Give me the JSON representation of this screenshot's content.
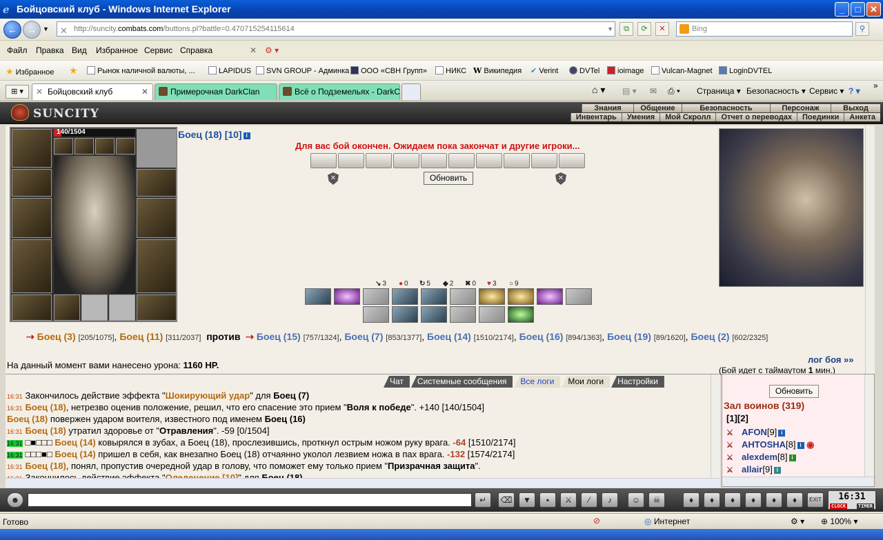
{
  "window": {
    "title": "Бойцовский клуб - Windows Internet Explorer",
    "minimize": "_",
    "maximize": "□",
    "close": "✕"
  },
  "address": {
    "url_prefix": "http://suncity.",
    "url_domain": "combats.com",
    "url_suffix": "/buttons.pl?battle=0.470715254115614",
    "search_placeholder": "Bing"
  },
  "menu": [
    "Файл",
    "Правка",
    "Вид",
    "Избранное",
    "Сервис",
    "Справка"
  ],
  "favorites": {
    "label": "Избранное",
    "items": [
      "Рынок наличной валюты, ...",
      "LAPIDUS",
      "SVN GROUP - Админка",
      "ООО «СВН Групп»",
      "НИКС",
      "Википедия",
      "Verint",
      "DVTel",
      "ioimage",
      "Vulcan-Magnet",
      "LoginDVTEL"
    ]
  },
  "tabs": [
    "Бойцовский клуб",
    "Примерочная DarkClan",
    "Всё о Подземельях - DarkCl..."
  ],
  "commandbar": [
    "Страница",
    "Безопасность",
    "Сервис"
  ],
  "game": {
    "logo": "SUNCITY",
    "nav_top": [
      "Знания",
      "Общение",
      "Безопасность",
      "Персонаж",
      "Выход"
    ],
    "nav_bottom": [
      "Инвентарь",
      "Умения",
      "Мой Скролл",
      "Отчет о переводах",
      "Поединки",
      "Анкета"
    ],
    "hp_text": "140/1504",
    "hp_fraction": 0.093,
    "fighter_name": "Боец (18)",
    "fighter_extra": "[10]",
    "battle_message": "Для вас бой окончен. Ожидаем пока закончат и другие игроки...",
    "refresh_label": "Обновить",
    "stats": [
      {
        "glyph": "↘",
        "value": "3"
      },
      {
        "glyph": "●",
        "value": "0"
      },
      {
        "glyph": "↻",
        "value": "5"
      },
      {
        "glyph": "◆",
        "value": "2"
      },
      {
        "glyph": "✖",
        "value": "0"
      },
      {
        "glyph": "♥",
        "value": "3"
      },
      {
        "glyph": "○",
        "value": "9"
      }
    ],
    "team1": [
      {
        "name": "Боец (3)",
        "hp": "[205/1075]"
      },
      {
        "name": "Боец (11)",
        "hp": "[311/2037]"
      }
    ],
    "versus": "против",
    "team2": [
      {
        "name": "Боец (15)",
        "hp": "[757/1324]"
      },
      {
        "name": "Боец (7)",
        "hp": "[853/1377]"
      },
      {
        "name": "Боец (14)",
        "hp": "[1510/2174]"
      },
      {
        "name": "Боец (16)",
        "hp": "[894/1363]"
      },
      {
        "name": "Боец (19)",
        "hp": "[89/1620]"
      },
      {
        "name": "Боец (2)",
        "hp": "[602/2325]"
      }
    ],
    "damage_prefix": "На данный момент вами нанесено урона:",
    "damage_value": "1160 HP.",
    "log_link": "лог боя »»",
    "timeout_text": "(Бой идет с таймаутом",
    "timeout_value": "1",
    "timeout_unit": "мин.)"
  },
  "log": {
    "tabs": [
      "Чат",
      "Системные сообщения",
      "Все логи",
      "Мои логи",
      "Настройки"
    ],
    "lines": [
      {
        "time": "16:31",
        "green": false,
        "a": "Закончилось действие эффекта \"",
        "b": "Шокирующий удар",
        "c": "\" для ",
        "d": "Боец (7)",
        "e": ""
      },
      {
        "time": "16:31",
        "green": false,
        "a": "",
        "b": "Боец (18)",
        "c": ", нетрезво оценив положение, решил, что его спасение это прием \"",
        "d": "Воля к победе",
        "e": "\". +140 [140/1504]"
      },
      {
        "time": "",
        "green": false,
        "a": "",
        "b": "Боец (18)",
        "c": " повержен ударом воителя, известного под именем ",
        "d": "Боец (16)",
        "e": ""
      },
      {
        "time": "16:31",
        "green": false,
        "a": "",
        "b": "Боец (18)",
        "c": " утратил здоровье от \"",
        "d": "Отравления",
        "e": "\". -59 [0/1504]"
      },
      {
        "time": "16:31",
        "green": true,
        "a": "□■□□□ ",
        "b": "Боец (14)",
        "c": " ковырялся в зубах, а Боец (18), прослезившись, проткнул острым ножом руку врага. ",
        "d": "-64",
        "e": " [1510/2174]"
      },
      {
        "time": "16:31",
        "green": true,
        "a": "□□□■□ ",
        "b": "Боец (14)",
        "c": " пришел в себя, как внезапно Боец (18) отчаянно уколол лезвием ножа в пах врага. ",
        "d": "-132",
        "e": " [1574/2174]"
      },
      {
        "time": "16:31",
        "green": false,
        "a": "",
        "b": "Боец (18)",
        "c": ", понял, пропустив очередной удар в голову, что поможет ему только прием \"",
        "d": "Призрачная защита",
        "e": "\"."
      },
      {
        "time": "16:31",
        "green": false,
        "a": "Закончилось действие эффекта \"",
        "b": "Оледенение [10]",
        "c": "\" для ",
        "d": "Боец (18)",
        "e": ""
      }
    ]
  },
  "players": {
    "refresh_label": "Обновить",
    "hall_title": "Зал воинов (319)",
    "pages": "[1][2]",
    "list": [
      {
        "name": "AFON",
        "level": "[9]"
      },
      {
        "name": "AHTOSHA",
        "level": "[8]"
      },
      {
        "name": "alexdem",
        "level": "[8]"
      },
      {
        "name": "allair",
        "level": "[9]"
      }
    ]
  },
  "clock": {
    "time": "16:31",
    "label1": "CLOCK",
    "label2": "TIMER"
  },
  "status": {
    "text": "Готово",
    "zone": "Интернет",
    "zoom": "100%"
  }
}
